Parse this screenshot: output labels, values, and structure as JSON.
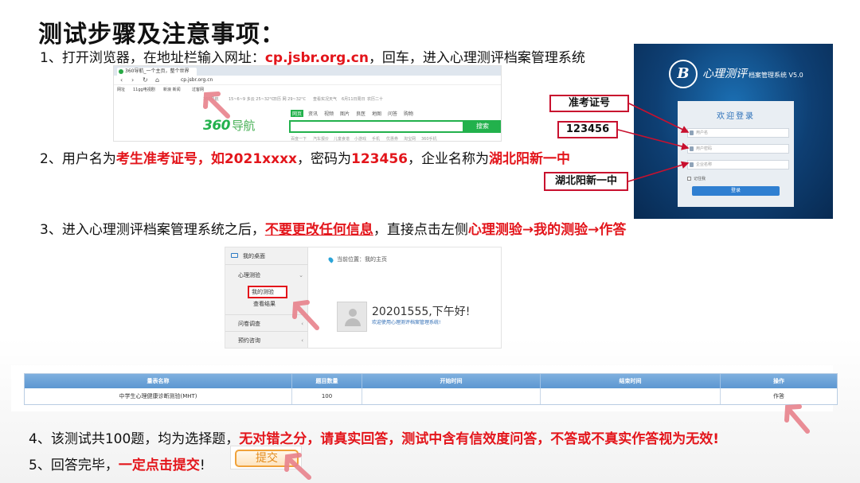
{
  "title": "测试步骤及注意事项：",
  "step1": {
    "prefix": "1、打开浏览器，在地址栏输入网址：",
    "url": "cp.jsbr.org.cn",
    "suffix": "，回车，进入心理测评档案管理系统"
  },
  "step2": {
    "p1": "2、用户名为",
    "h1": "考生准考证号，如2021xxxx",
    "p2": "，密码为",
    "h2": "123456",
    "p3": "，企业名称为",
    "h3": "湖北阳新一中"
  },
  "step3": {
    "p1": "3、进入心理测评档案管理系统之后，",
    "h1": "不要更改任何信息",
    "p2": "，直接点击左侧",
    "h2": "心理测验→我的测验→作答"
  },
  "step4": {
    "p1": "4、该测试共100题，均为选择题，",
    "h1": "无对错之分，请真实回答，测试中含有信效度问答，不答或不真实作答视为无效!"
  },
  "step5": {
    "p1": "5、回答完毕，",
    "h1": "一定点击提交",
    "p2": "!"
  },
  "browser": {
    "tab_title": "360导航_一个主页，整个世界",
    "url": "cp.jsbr.org.cn",
    "bookmarks": [
      "网址",
      "11gg电视剧",
      "新浪 新闻",
      "过客网"
    ],
    "weather": [
      "360导航",
      "15~6~9 多云 25~32°C",
      "日历 网 29~32°C",
      "查看实况天气",
      "6月11日周日",
      "农历二十"
    ],
    "logo": "360",
    "logo_suffix": "导航",
    "search_tabs": [
      "网页",
      "资讯",
      "视频",
      "图片",
      "良医",
      "地图",
      "问答",
      "购物"
    ],
    "search_button": "搜索",
    "hot_words": [
      "百度一下",
      "汽车报价",
      "儿童食谱",
      "小游戏",
      "手机",
      "优惠券",
      "淘宝网",
      "360手机"
    ]
  },
  "login": {
    "emblem": "B",
    "system_name": "心理测评",
    "system_suffix": "档案管理系统 V5.0",
    "welcome": "欢迎登录",
    "username_placeholder": "用户名",
    "password_placeholder": "用户密码",
    "company_placeholder": "企业名称",
    "remember": "记住我",
    "login_button": "登录"
  },
  "callouts": {
    "username": "准考证号",
    "password": "123456",
    "company": "湖北阳新一中"
  },
  "sidebar": {
    "desktop": "我的桌面",
    "psych_test": "心理测验",
    "my_tests": "我的测验",
    "view_results": "查看结果",
    "survey": "问卷调查",
    "appointment": "预约咨询",
    "breadcrumb": "当前位置：我的主页",
    "greeting": "20201555,下午好!",
    "welcome_msg": "欢迎使用心理测评档案管理系统!"
  },
  "table": {
    "headers": [
      "量表名称",
      "题目数量",
      "开始时间",
      "结束时间",
      "操作"
    ],
    "rows": [
      [
        "中学生心理健康诊断测验(MHT)",
        "100",
        "",
        "",
        "作答"
      ]
    ]
  },
  "submit_label": "提交",
  "colors": {
    "highlight_red": "#e3151b",
    "login_blue": "#0e3f73",
    "nav_green": "#22b14c",
    "table_header": "#6aa3d8",
    "submit_orange": "#f0a23a"
  }
}
